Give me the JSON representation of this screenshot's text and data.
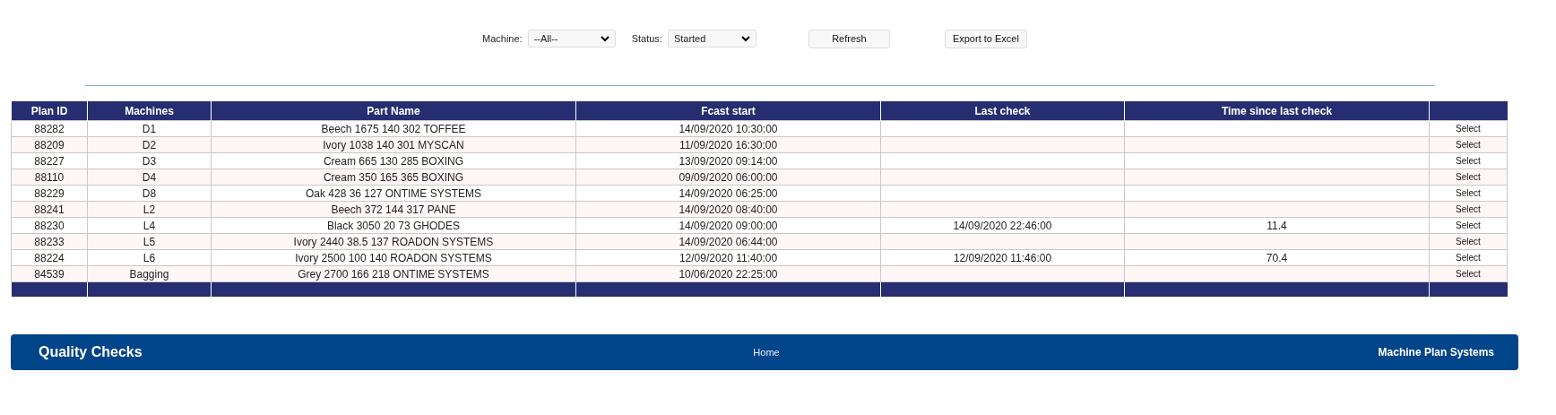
{
  "filters": [
    {
      "label": "Machine:",
      "value": "--All--"
    },
    {
      "label": "Status:",
      "value": "Started"
    }
  ],
  "buttons": [
    "Refresh",
    "Export to Excel"
  ],
  "table": {
    "columns": [
      "Plan ID",
      "Machines",
      "Part Name",
      "Fcast start",
      "Last check",
      "Time since last check"
    ],
    "rows": [
      {
        "plan_id": "88282",
        "machine": "D1",
        "part_name": "Beech 1675 140 302 TOFFEE",
        "fcast_start": "14/09/2020 10:30:00",
        "action": "Select"
      },
      {
        "plan_id": "88209",
        "machine": "D2",
        "part_name": "Ivory 1038 140 301 MYSCAN",
        "fcast_start": "11/09/2020 16:30:00",
        "action": "Select"
      },
      {
        "plan_id": "88227",
        "machine": "D3",
        "part_name": "Cream 665 130 285 BOXING",
        "fcast_start": "13/09/2020 09:14:00",
        "action": "Select"
      },
      {
        "plan_id": "88110",
        "machine": "D4",
        "part_name": "Cream 350 165 365 BOXING",
        "fcast_start": "09/09/2020 06:00:00",
        "action": "Select"
      },
      {
        "plan_id": "88229",
        "machine": "D8",
        "part_name": "Oak 428 36 127 ONTIME SYSTEMS",
        "fcast_start": "14/09/2020 06:25:00",
        "action": "Select"
      },
      {
        "plan_id": "88241",
        "machine": "L2",
        "part_name": "Beech 372 144 317 PANE",
        "fcast_start": "14/09/2020 08:40:00",
        "action": "Select"
      },
      {
        "plan_id": "88230",
        "machine": "L4",
        "part_name": "Black 3050 20 73 GHODES",
        "fcast_start": "14/09/2020 09:00:00",
        "last_check": "14/09/2020 22:46:00",
        "time_since": "11.4",
        "action": "Select"
      },
      {
        "plan_id": "88233",
        "machine": "L5",
        "part_name": "Ivory 2440 38.5 137 ROADON SYSTEMS",
        "fcast_start": "14/09/2020 06:44:00",
        "action": "Select"
      },
      {
        "plan_id": "88224",
        "machine": "L6",
        "part_name": "Ivory 2500 100 140 ROADON SYSTEMS",
        "fcast_start": "12/09/2020 11:40:00",
        "last_check": "12/09/2020 11:46:00",
        "time_since": "70.4",
        "action": "Select"
      },
      {
        "plan_id": "84539",
        "machine": "Bagging",
        "part_name": "Grey 2700 166 218 ONTIME SYSTEMS",
        "fcast_start": "10/06/2020 22:25:00",
        "action": "Select"
      }
    ]
  },
  "footer": {
    "title": "Quality Checks",
    "link": "Home",
    "brand": "Machine Plan Systems"
  }
}
